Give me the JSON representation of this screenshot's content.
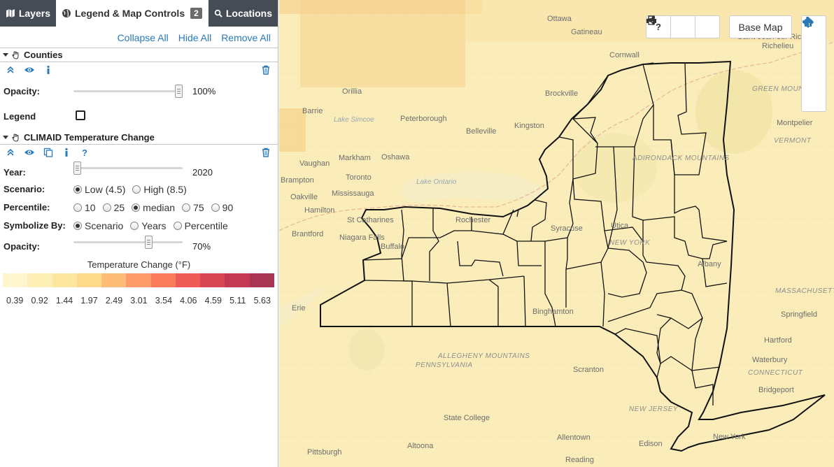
{
  "tabs": [
    {
      "label": "Layers",
      "icon": "map-icon"
    },
    {
      "label": "Legend & Map Controls",
      "icon": "globe-icon",
      "badge": "2"
    },
    {
      "label": "Locations",
      "icon": "search-icon"
    }
  ],
  "actions": {
    "collapse_all": "Collapse All",
    "hide_all": "Hide All",
    "remove_all": "Remove All"
  },
  "counties": {
    "title": "Counties",
    "opacity_label": "Opacity:",
    "opacity_value": "100%",
    "opacity_fraction": 1.0,
    "legend_label": "Legend",
    "legend_checked": false
  },
  "climaid": {
    "title": "CLIMAID Temperature Change",
    "year_label": "Year:",
    "year_value": "2020",
    "year_fraction": 0.0,
    "scenario_label": "Scenario:",
    "scenario_options": [
      "Low (4.5)",
      "High (8.5)"
    ],
    "scenario_selected": 0,
    "percentile_label": "Percentile:",
    "percentile_options": [
      "10",
      "25",
      "median",
      "75",
      "90"
    ],
    "percentile_selected": 2,
    "symbolize_label": "Symbolize By:",
    "symbolize_options": [
      "Scenario",
      "Years",
      "Percentile"
    ],
    "symbolize_selected": 0,
    "opacity_label": "Opacity:",
    "opacity_value": "70%",
    "opacity_fraction": 0.7
  },
  "legend": {
    "title": "Temperature Change (°F)",
    "colors": [
      "#fff6d0",
      "#fdf0b7",
      "#fde6a0",
      "#fdd98c",
      "#fdbc78",
      "#fd9c68",
      "#fa7c5c",
      "#ee5a55",
      "#d64554",
      "#c43855",
      "#a93353"
    ],
    "ticks": [
      "0.39",
      "0.92",
      "1.44",
      "1.97",
      "2.49",
      "3.01",
      "3.54",
      "4.06",
      "4.59",
      "5.11",
      "5.63"
    ]
  },
  "map": {
    "help_label": "?",
    "base_map_label": "Base Map",
    "place_labels": [
      "Ottawa",
      "Gatineau",
      "Cornwall",
      "Brockville",
      "Kingston",
      "Belleville",
      "Peterborough",
      "Orillia",
      "Barrie",
      "Vaughan",
      "Markham",
      "Oshawa",
      "Brampton",
      "Toronto",
      "Oakville",
      "Mississauga",
      "Hamilton",
      "Brantford",
      "St Catharines",
      "Niagara Falls",
      "Buffalo",
      "Rochester",
      "Syracuse",
      "Utica",
      "NEW YORK",
      "Albany",
      "Erie",
      "Binghamton",
      "Scranton",
      "PENNSYLVANIA",
      "State College",
      "Altoona",
      "Pittsburgh",
      "Allentown",
      "Reading",
      "Edison",
      "NEW JERSEY",
      "New York",
      "Bridgeport",
      "CONNECTICUT",
      "Waterbury",
      "Hartford",
      "Springfield",
      "MASSACHUSETTS",
      "Montpelier",
      "VERMONT",
      "GREEN MOUNTAINS",
      "ADIRONDACK MOUNTAINS",
      "ALLEGHENY MOUNTAINS",
      "Lake Ontario",
      "Lake Simcoe",
      "Saint-Jean-sur-Richelieu",
      "Richelieu"
    ]
  }
}
